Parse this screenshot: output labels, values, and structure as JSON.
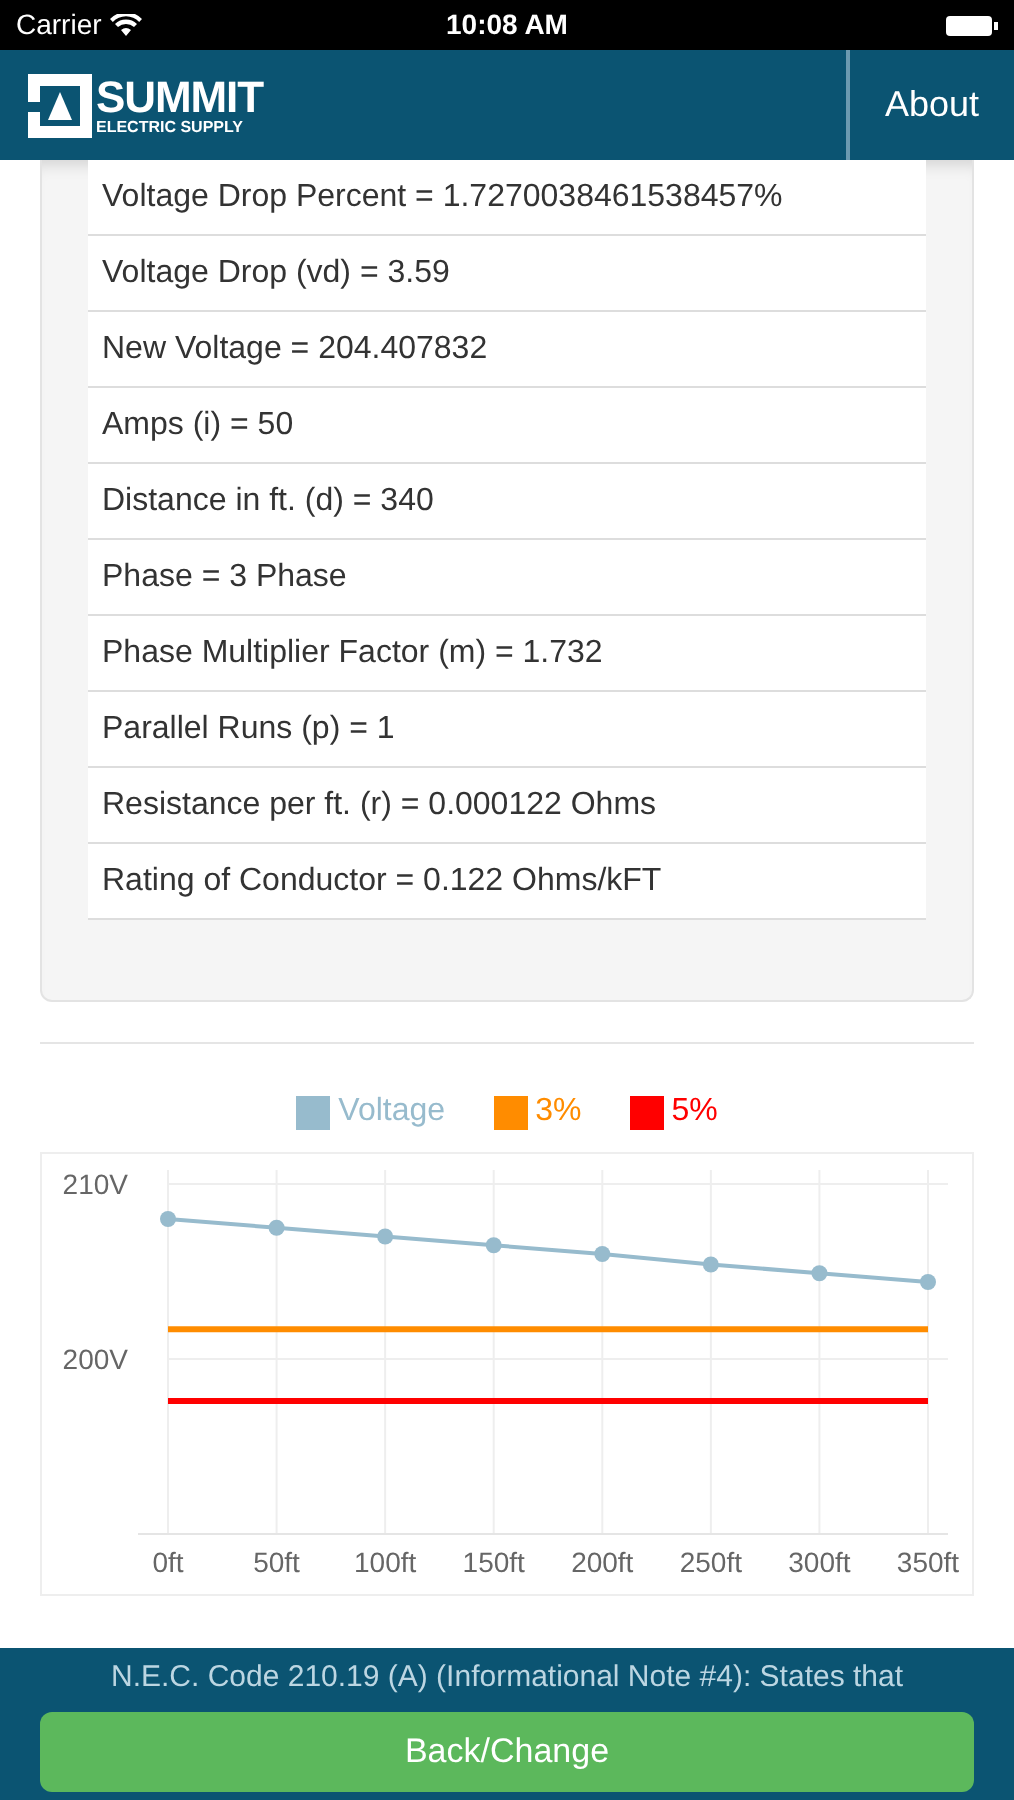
{
  "status_bar": {
    "carrier": "Carrier",
    "time": "10:08 AM"
  },
  "header": {
    "logo": {
      "name": "SUMMIT",
      "tagline": "ELECTRIC SUPPLY"
    },
    "nav_link": "About"
  },
  "results": [
    {
      "text": "Voltage Drop Percent = 1.7270038461538457%"
    },
    {
      "text": "Voltage Drop (vd) = 3.59"
    },
    {
      "text": "New Voltage = 204.407832"
    },
    {
      "text": "Amps (i) = 50"
    },
    {
      "text": "Distance in ft. (d) = 340"
    },
    {
      "text": "Phase = 3 Phase"
    },
    {
      "text": "Phase Multiplier Factor (m) = 1.732"
    },
    {
      "text": "Parallel Runs (p) = 1"
    },
    {
      "text": "Resistance per ft. (r) = 0.000122 Ohms"
    },
    {
      "text": "Rating of Conductor = 0.122 Ohms/kFT"
    }
  ],
  "chart": {
    "chart_data": {
      "type": "line",
      "categories": [
        "0ft",
        "50ft",
        "100ft",
        "150ft",
        "200ft",
        "250ft",
        "300ft",
        "350ft"
      ],
      "ylim": [
        190,
        210.8
      ],
      "yticks": [
        {
          "value": 200,
          "label": "200V"
        },
        {
          "value": 210,
          "label": "210V"
        }
      ],
      "grid": true,
      "legend": "top",
      "series": [
        {
          "name": "Voltage",
          "color": "#97bbcd",
          "marker": "circle",
          "values": [
            208,
            207.5,
            207,
            206.5,
            206,
            205.4,
            204.9,
            204.4
          ]
        },
        {
          "name": "3%",
          "color": "#ff8c00",
          "values": [
            201.7,
            201.7,
            201.7,
            201.7,
            201.7,
            201.7,
            201.7,
            201.7
          ]
        },
        {
          "name": "5%",
          "color": "#ff0000",
          "values": [
            197.6,
            197.6,
            197.6,
            197.6,
            197.6,
            197.6,
            197.6,
            197.6
          ]
        }
      ]
    }
  },
  "note": "N.E.C. Code 210.19 (A) (Informational Note #4): States that",
  "footer_button": "Back/Change"
}
